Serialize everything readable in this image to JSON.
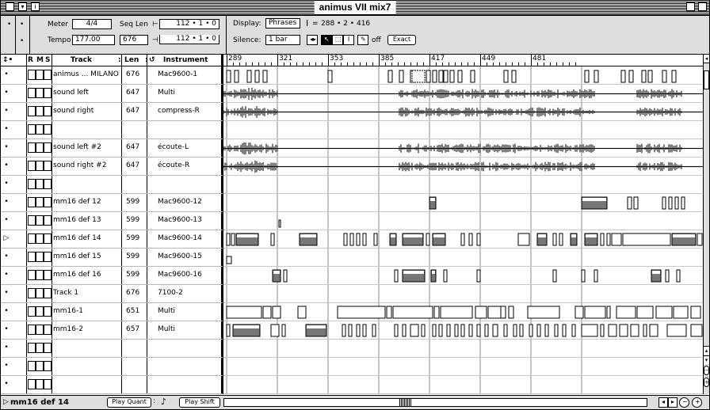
{
  "window": {
    "title": "animus VII mix7"
  },
  "controls": {
    "meter_label": "Meter",
    "meter_value": "4/4",
    "tempo_label": "Tempo",
    "tempo_value": "177.00",
    "seqlen_label": "Seq Len",
    "seqlen_value": "676",
    "start_value": "112 • 1 • 0",
    "end_value": "112 • 1 • 0",
    "display_label": "Display:",
    "display_value": "Phrases",
    "position_value": "288 • 2 • 416",
    "silence_label": "Silence:",
    "silence_value": "1 bar",
    "off_label": "off",
    "exact_label": "Exact"
  },
  "list_header": {
    "r": "R",
    "m": "M",
    "s": "S",
    "track": "Track",
    "len": "Len",
    "instrument": "Instrument"
  },
  "tracks": [
    {
      "name": "animus ... MILANO",
      "len": "676",
      "inst": "Mac9600-1"
    },
    {
      "name": "sound left",
      "len": "647",
      "inst": "Multi"
    },
    {
      "name": "sound right",
      "len": "647",
      "inst": "compress-R"
    },
    {
      "name": "",
      "len": "",
      "inst": ""
    },
    {
      "name": "sound left #2",
      "len": "647",
      "inst": "écoute-L"
    },
    {
      "name": "sound right #2",
      "len": "647",
      "inst": "écoute-R"
    },
    {
      "name": "",
      "len": "",
      "inst": ""
    },
    {
      "name": "mm16 def 12",
      "len": "599",
      "inst": "Mac9600-12"
    },
    {
      "name": "mm16 def 13",
      "len": "599",
      "inst": "Mac9600-13"
    },
    {
      "name": "mm16 def 14",
      "len": "599",
      "inst": "Mac9600-14"
    },
    {
      "name": "mm16 def 15",
      "len": "599",
      "inst": "Mac9600-15"
    },
    {
      "name": "mm16 def 16",
      "len": "599",
      "inst": "Mac9600-16"
    },
    {
      "name": "Track 1",
      "len": "676",
      "inst": "7100-2"
    },
    {
      "name": "mm16-1",
      "len": "651",
      "inst": "Multi"
    },
    {
      "name": "mm16-2",
      "len": "657",
      "inst": "Multi"
    },
    {
      "name": "",
      "len": "",
      "inst": ""
    },
    {
      "name": "",
      "len": "",
      "inst": ""
    },
    {
      "name": "",
      "len": "",
      "inst": ""
    }
  ],
  "ruler": [
    "289",
    "321",
    "353",
    "385",
    "417",
    "449",
    "481"
  ],
  "footer": {
    "selected_track": "mm16 def 14",
    "play_quant": "Play Quant",
    "play_shift": "Play Shift"
  }
}
